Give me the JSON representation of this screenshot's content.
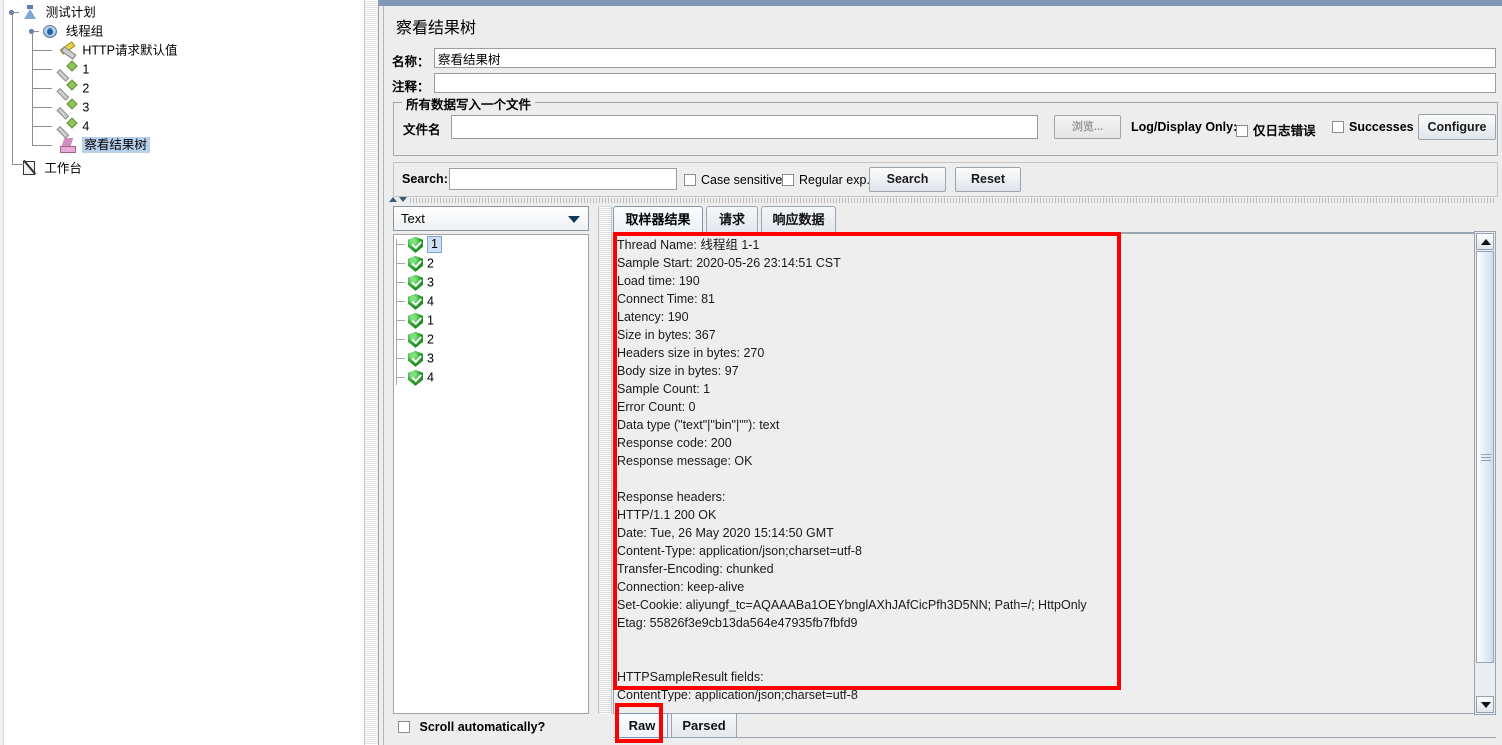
{
  "window": {
    "title": "察看结果树"
  },
  "tree": {
    "nodes": [
      {
        "label": "测试计划",
        "icon": "test-plan-icon",
        "selected": false
      },
      {
        "label": "线程组",
        "icon": "thread-group-icon",
        "selected": false
      },
      {
        "label": "HTTP请求默认值",
        "icon": "http-defaults-icon",
        "selected": false
      },
      {
        "label": "1",
        "icon": "http-sampler-icon",
        "selected": false
      },
      {
        "label": "2",
        "icon": "http-sampler-icon",
        "selected": false
      },
      {
        "label": "3",
        "icon": "http-sampler-icon",
        "selected": false
      },
      {
        "label": "4",
        "icon": "http-sampler-icon",
        "selected": false
      },
      {
        "label": "察看结果树",
        "icon": "view-results-tree-icon",
        "selected": true
      },
      {
        "label": "工作台",
        "icon": "workbench-icon",
        "selected": false
      }
    ]
  },
  "form": {
    "name_label": "名称：",
    "name_value": "察看结果树",
    "comment_label": "注释：",
    "comment_value": "",
    "groupbox_title": "所有数据写入一个文件",
    "filename_label": "文件名",
    "filename_value": "",
    "browse_button": "浏览...",
    "log_display_only_label": "Log/Display Only:",
    "errors_only_checkbox": "仅日志错误",
    "successes_checkbox": "Successes",
    "configure_button": "Configure"
  },
  "search": {
    "label": "Search:",
    "value": "",
    "case_sensitive": "Case sensitive",
    "regular_exp": "Regular exp.",
    "search_button": "Search",
    "reset_button": "Reset"
  },
  "results": {
    "render_selected": "Text",
    "items": [
      {
        "label": "1",
        "status": "success",
        "selected": true
      },
      {
        "label": "2",
        "status": "success",
        "selected": false
      },
      {
        "label": "3",
        "status": "success",
        "selected": false
      },
      {
        "label": "4",
        "status": "success",
        "selected": false
      },
      {
        "label": "1",
        "status": "success",
        "selected": false
      },
      {
        "label": "2",
        "status": "success",
        "selected": false
      },
      {
        "label": "3",
        "status": "success",
        "selected": false
      },
      {
        "label": "4",
        "status": "success",
        "selected": false
      }
    ],
    "scroll_automatically": "Scroll automatically?"
  },
  "tabs": [
    {
      "label": "取样器结果",
      "active": true
    },
    {
      "label": "请求",
      "active": false
    },
    {
      "label": "响应数据",
      "active": false
    }
  ],
  "sampler_result": {
    "lines": [
      "Thread Name: 线程组 1-1",
      "Sample Start: 2020-05-26 23:14:51 CST",
      "Load time: 190",
      "Connect Time: 81",
      "Latency: 190",
      "Size in bytes: 367",
      "Headers size in bytes: 270",
      "Body size in bytes: 97",
      "Sample Count: 1",
      "Error Count: 0",
      "Data type (\"text\"|\"bin\"|\"\"): text",
      "Response code: 200",
      "Response message: OK",
      "",
      "Response headers:",
      "HTTP/1.1 200 OK",
      "Date: Tue, 26 May 2020 15:14:50 GMT",
      "Content-Type: application/json;charset=utf-8",
      "Transfer-Encoding: chunked",
      "Connection: keep-alive",
      "Set-Cookie: aliyungf_tc=AQAAABa1OEYbnglAXhJAfCicPfh3D5NN; Path=/; HttpOnly",
      "Etag: 55826f3e9cb13da564e47935fb7fbfd9",
      "",
      "",
      "HTTPSampleResult fields:",
      "ContentType: application/json;charset=utf-8"
    ]
  },
  "view_mode": {
    "raw": "Raw",
    "parsed": "Parsed",
    "active": "Raw"
  },
  "colors": {
    "annotation": "#ff0000",
    "panel_bg": "#ededed",
    "selection": "#b7d1ea",
    "success": "#2aa32a",
    "titlebar": "#7f98b5"
  }
}
